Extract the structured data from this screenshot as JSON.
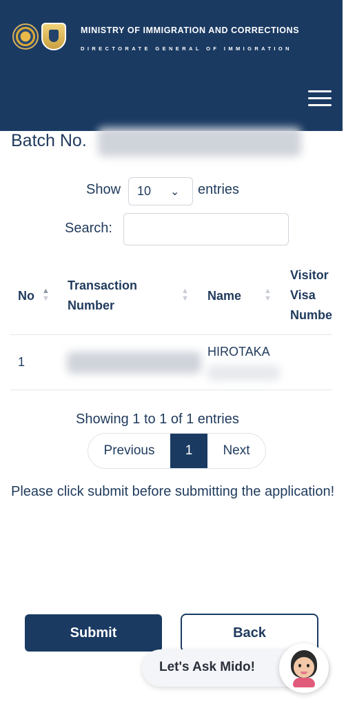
{
  "header": {
    "ministry": "MINISTRY OF IMMIGRATION AND CORRECTIONS",
    "directorate": "DIRECTORATE GENERAL OF IMMIGRATION",
    "logos": [
      "emblem-icon",
      "immigration-badge-icon"
    ],
    "menu_icon": "hamburger-icon",
    "background_color": "#1a3a62"
  },
  "batch": {
    "label": "Batch No."
  },
  "controls": {
    "show_label": "Show",
    "page_size": "10",
    "entries_label": "entries",
    "search_label": "Search:",
    "search_value": ""
  },
  "table": {
    "columns": [
      "No",
      "Transaction Number",
      "Name",
      "Visitor Visa Number"
    ],
    "rows": [
      {
        "no": "1",
        "name": "HIROTAKA"
      }
    ]
  },
  "pagination": {
    "info": "Showing 1 to 1 of 1 entries",
    "previous": "Previous",
    "current": "1",
    "next": "Next"
  },
  "note": "Please click submit before submitting the application!",
  "actions": {
    "submit": "Submit",
    "back": "Back"
  },
  "chat": {
    "label": "Let's Ask Mido!",
    "avatar_icon": "assistant-avatar-icon"
  },
  "colors": {
    "primary": "#1a3a62",
    "text": "#1f3a5c"
  }
}
